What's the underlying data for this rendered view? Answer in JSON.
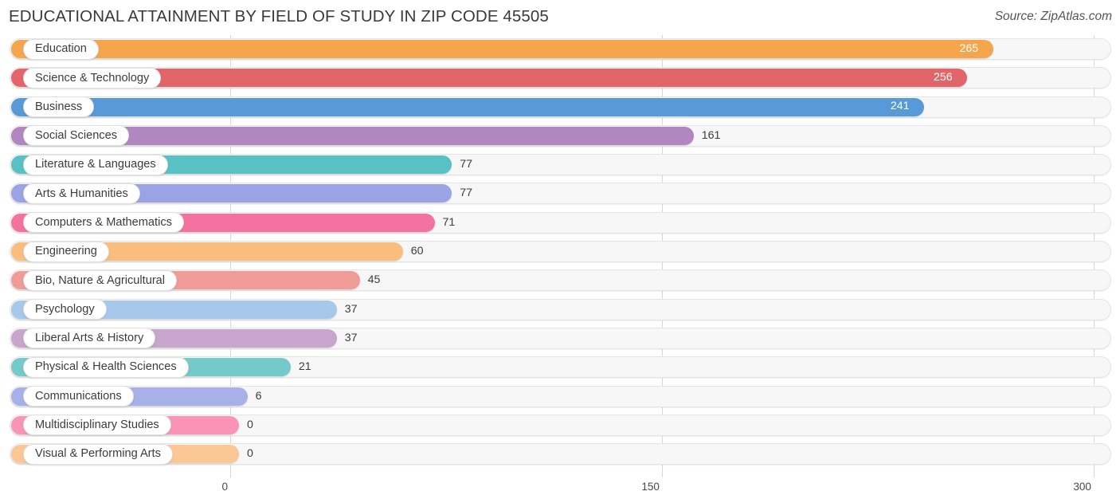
{
  "header": {
    "title": "EDUCATIONAL ATTAINMENT BY FIELD OF STUDY IN ZIP CODE 45505",
    "source": "Source: ZipAtlas.com"
  },
  "chart_data": {
    "type": "bar",
    "orientation": "horizontal",
    "title": "EDUCATIONAL ATTAINMENT BY FIELD OF STUDY IN ZIP CODE 45505",
    "xlabel": "",
    "ylabel": "",
    "xlim": [
      0,
      300
    ],
    "xticks": [
      0,
      150,
      300
    ],
    "xtick_labels": [
      "0",
      "150",
      "300"
    ],
    "grid": true,
    "legend": null,
    "categories": [
      "Education",
      "Science & Technology",
      "Business",
      "Social Sciences",
      "Literature & Languages",
      "Arts & Humanities",
      "Computers & Mathematics",
      "Engineering",
      "Bio, Nature & Agricultural",
      "Psychology",
      "Liberal Arts & History",
      "Physical & Health Sciences",
      "Communications",
      "Multidisciplinary Studies",
      "Visual & Performing Arts"
    ],
    "values": [
      265,
      256,
      241,
      161,
      77,
      77,
      71,
      60,
      45,
      37,
      37,
      21,
      6,
      0,
      0
    ],
    "value_labels": [
      "265",
      "256",
      "241",
      "161",
      "77",
      "77",
      "71",
      "60",
      "45",
      "37",
      "37",
      "21",
      "6",
      "0",
      "0"
    ],
    "colors": [
      "#f6a košt"
    ]
  },
  "bars": [
    {
      "label": "Education",
      "value": 265,
      "value_label": "265",
      "color": "#f5a54c",
      "label_inside": true
    },
    {
      "label": "Science & Technology",
      "value": 256,
      "value_label": "256",
      "color": "#e2656a",
      "label_inside": true
    },
    {
      "label": "Business",
      "value": 241,
      "value_label": "241",
      "color": "#5899d7",
      "label_inside": true
    },
    {
      "label": "Social Sciences",
      "value": 161,
      "value_label": "161",
      "color": "#b287bf",
      "label_inside": false
    },
    {
      "label": "Literature & Languages",
      "value": 77,
      "value_label": "77",
      "color": "#57c1c4",
      "label_inside": false
    },
    {
      "label": "Arts & Humanities",
      "value": 77,
      "value_label": "77",
      "color": "#9aa3e4",
      "label_inside": false
    },
    {
      "label": "Computers & Mathematics",
      "value": 71,
      "value_label": "71",
      "color": "#f472a0",
      "label_inside": false
    },
    {
      "label": "Engineering",
      "value": 60,
      "value_label": "60",
      "color": "#f9bd7e",
      "label_inside": false
    },
    {
      "label": "Bio, Nature & Agricultural",
      "value": 45,
      "value_label": "45",
      "color": "#ef9b98",
      "label_inside": false
    },
    {
      "label": "Psychology",
      "value": 37,
      "value_label": "37",
      "color": "#a6c8ea",
      "label_inside": false
    },
    {
      "label": "Liberal Arts & History",
      "value": 37,
      "value_label": "37",
      "color": "#c8a5cc",
      "label_inside": false
    },
    {
      "label": "Physical & Health Sciences",
      "value": 21,
      "value_label": "21",
      "color": "#74c9ca",
      "label_inside": false
    },
    {
      "label": "Communications",
      "value": 6,
      "value_label": "6",
      "color": "#a8b0e8",
      "label_inside": false
    },
    {
      "label": "Multidisciplinary Studies",
      "value": 0,
      "value_label": "0",
      "color": "#f994b7",
      "label_inside": false
    },
    {
      "label": "Visual & Performing Arts",
      "value": 0,
      "value_label": "0",
      "color": "#fac795",
      "label_inside": false
    }
  ],
  "axis": {
    "ticks": [
      {
        "label": "0",
        "value": 0
      },
      {
        "label": "150",
        "value": 150
      },
      {
        "label": "300",
        "value": 300
      }
    ]
  }
}
